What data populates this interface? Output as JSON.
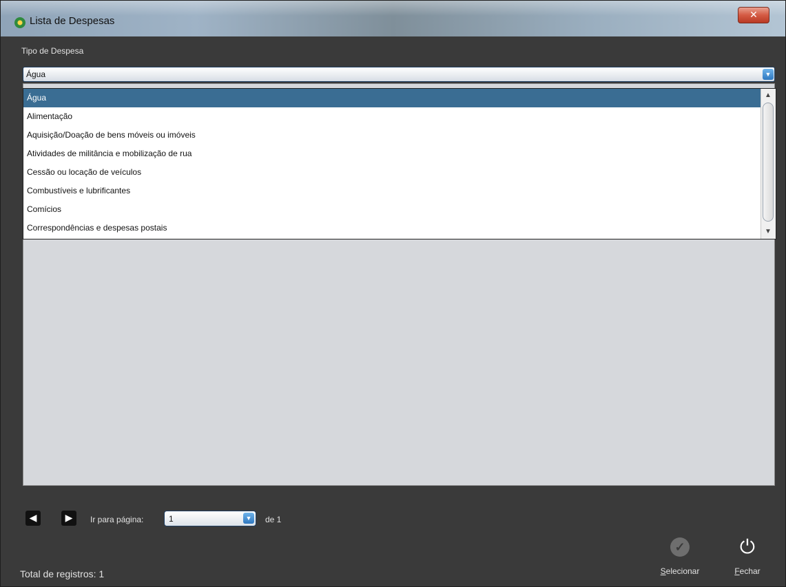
{
  "window": {
    "title": "Lista de Despesas",
    "close_symbol": "✕"
  },
  "filter": {
    "label": "Tipo de Despesa",
    "selected": "Água"
  },
  "dropdown": {
    "items": [
      "Água",
      "Alimentação",
      "Aquisição/Doação de bens móveis ou imóveis",
      "Atividades de militância e mobilização de rua",
      "Cessão ou locação de veículos",
      "Combustíveis e lubrificantes",
      "Comícios",
      "Correspondências e despesas postais"
    ],
    "selected_index": 0
  },
  "pagination": {
    "prev_icon": "arrow-left-icon",
    "next_icon": "arrow-right-icon",
    "goto_label": "Ir para página:",
    "current_page": "1",
    "of_label": "de 1"
  },
  "footer": {
    "total_label": "Total de registros: 1",
    "select_button": {
      "accesskey": "S",
      "rest": "elecionar",
      "icon": "checkmark-icon"
    },
    "close_button": {
      "accesskey": "F",
      "rest": "echar",
      "icon": "power-icon"
    }
  }
}
